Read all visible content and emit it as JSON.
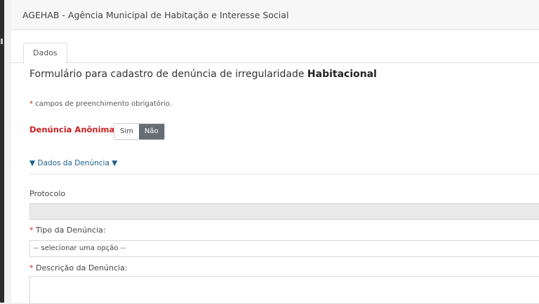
{
  "header": {
    "title": "AGEHAB - Agência Municipal de Habitação e Interesse Social"
  },
  "tabs": [
    {
      "label": "Dados"
    }
  ],
  "form": {
    "title_prefix": "Formulário para cadastro de denúncia de irregularidade",
    "title_bold": "Habitacional",
    "required_asterisk": "*",
    "required_note": "campos de preenchimento obrigatório.",
    "anonymous": {
      "label": "Denúncia Anônima:",
      "options": [
        "Sim",
        "Não"
      ],
      "selected": "Não"
    },
    "section_toggle": "▼ Dados da Denúncia ▼",
    "fields": {
      "protocolo": {
        "label": "Protocolo",
        "value": ""
      },
      "tipo": {
        "label": "Tipo da Denúncia:",
        "selected_value": "-- selecionar uma opção --"
      },
      "descricao": {
        "label": "Descrição da Denúncia:",
        "value": ""
      }
    }
  },
  "colors": {
    "required": "#cc1f1f",
    "toggle_active": "#666e75",
    "link": "#1d5f8a"
  }
}
